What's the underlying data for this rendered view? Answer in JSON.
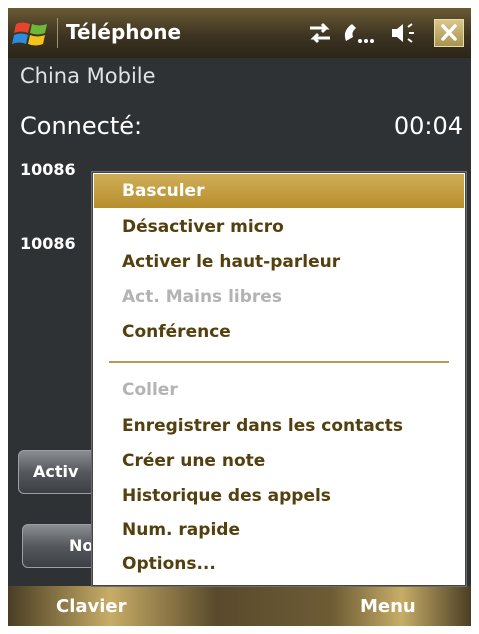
{
  "titlebar": {
    "title": "Téléphone",
    "icons": [
      "windows-start-icon",
      "connectivity-arrows-icon",
      "call-active-icon",
      "speaker-volume-icon",
      "close-icon"
    ],
    "close_label": "✕"
  },
  "call": {
    "carrier": "China Mobile",
    "status": "Connecté:",
    "timer": "00:04",
    "lines": [
      "10086",
      "10086"
    ]
  },
  "side_buttons": [
    "Activ",
    "No"
  ],
  "menu": {
    "items": [
      {
        "label": "Basculer",
        "state": "selected"
      },
      {
        "label": "Désactiver micro",
        "state": "enabled"
      },
      {
        "label": "Activer le haut-parleur",
        "state": "enabled"
      },
      {
        "label": "Act. Mains libres",
        "state": "disabled"
      },
      {
        "label": "Conférence",
        "state": "enabled"
      },
      {
        "label": "Coller",
        "state": "disabled"
      },
      {
        "label": "Enregistrer dans les contacts",
        "state": "enabled"
      },
      {
        "label": "Créer une note",
        "state": "enabled"
      },
      {
        "label": "Historique des appels",
        "state": "enabled"
      },
      {
        "label": "Num. rapide",
        "state": "enabled"
      },
      {
        "label": "Options...",
        "state": "enabled"
      }
    ]
  },
  "softkeys": {
    "left": "Clavier",
    "right": "Menu"
  },
  "colors": {
    "menu_highlight": "#c19a3c",
    "menu_text": "#54400e",
    "disabled_text": "#b3b3b3",
    "background": "#2e3235"
  }
}
